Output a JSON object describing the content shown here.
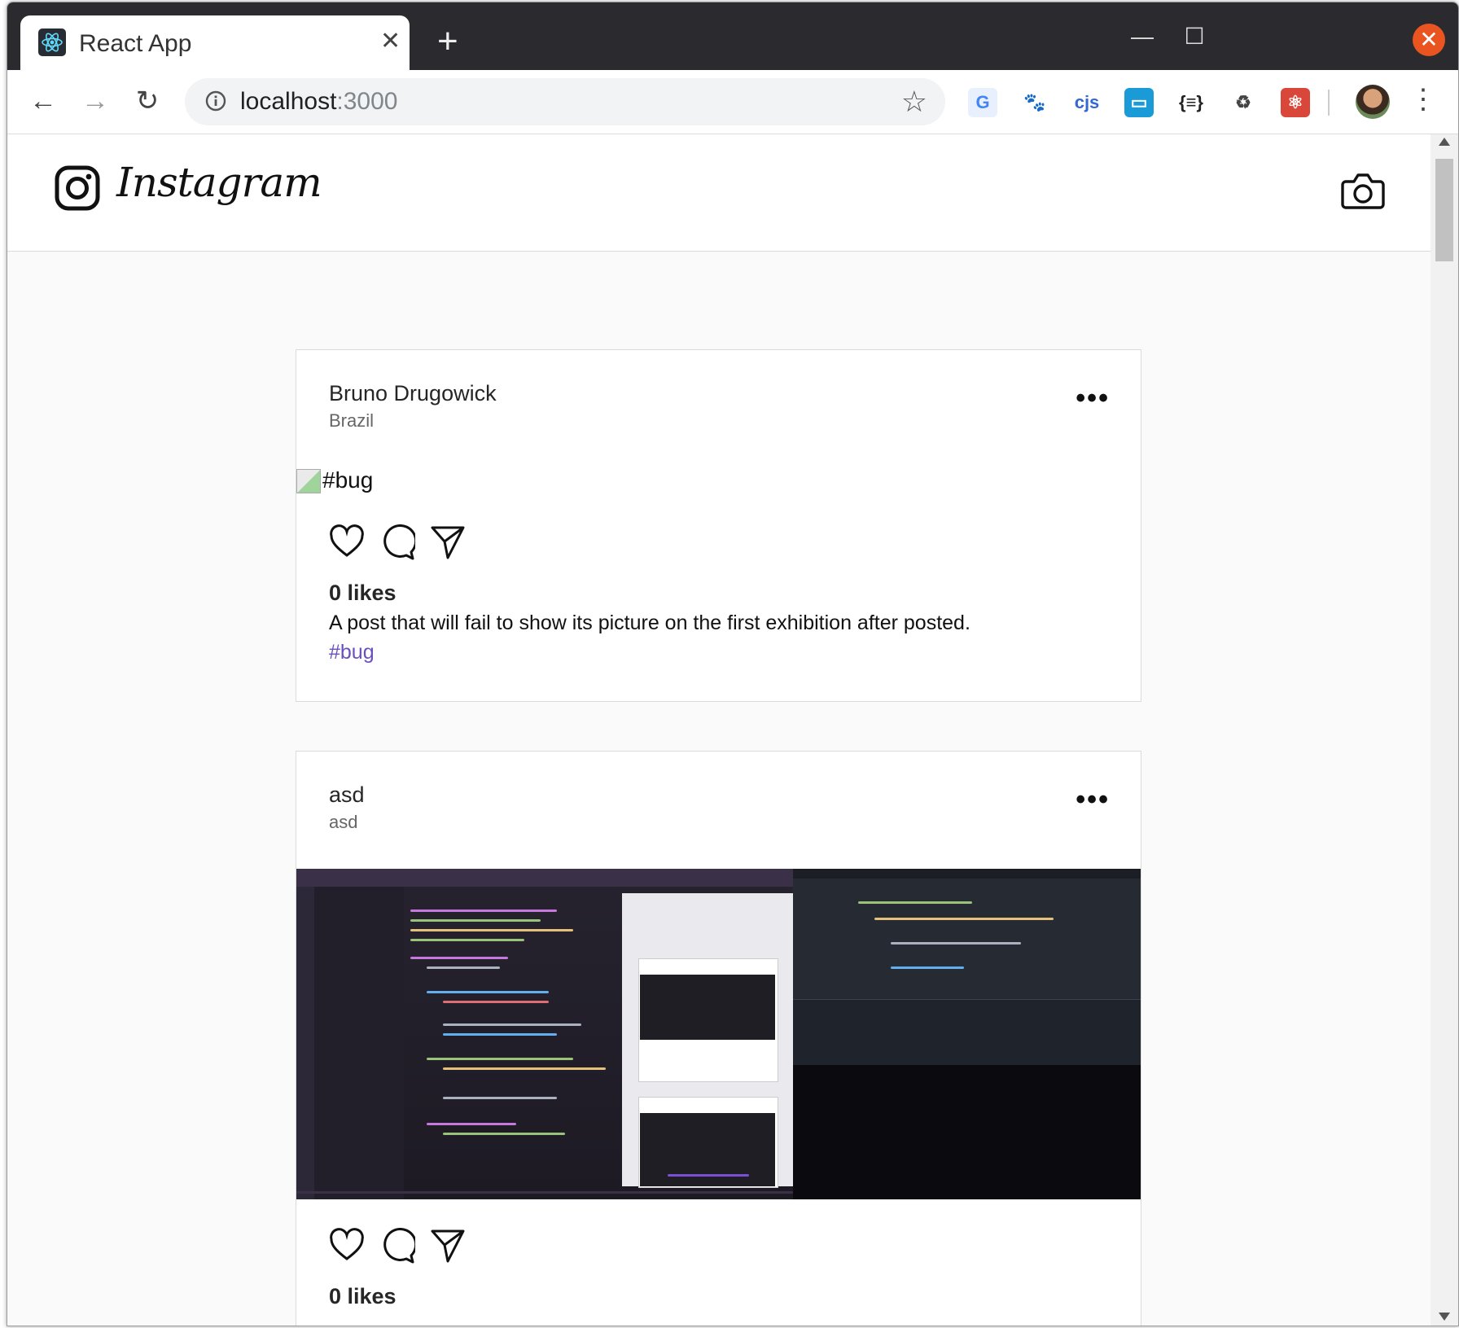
{
  "browser": {
    "tab_title": "React App",
    "tab_close": "✕",
    "new_tab": "+",
    "url_host": "localhost",
    "url_port": ":3000",
    "back": "←",
    "forward": "→",
    "reload": "↻",
    "star": "☆",
    "menu": "⋮",
    "min": "—",
    "max": "☐",
    "close": "✕",
    "extensions": [
      {
        "name": "google-translate-extension-icon",
        "label": "G",
        "color": "#4285f4",
        "bg": "#e8f0fe"
      },
      {
        "name": "gnome-extension-icon",
        "label": "🐾",
        "color": "#111111",
        "bg": "#ffffff"
      },
      {
        "name": "cjs-extension-icon",
        "label": "cjs",
        "color": "#3367d6",
        "bg": "#ffffff"
      },
      {
        "name": "window-extension-icon",
        "label": "▭",
        "color": "#ffffff",
        "bg": "#1a9bd7"
      },
      {
        "name": "json-formatter-extension-icon",
        "label": "{≡}",
        "color": "#222222",
        "bg": "#ffffff"
      },
      {
        "name": "recycle-extension-icon",
        "label": "♻",
        "color": "#444444",
        "bg": "#ffffff"
      },
      {
        "name": "react-devtools-extension-icon",
        "label": "⚛",
        "color": "#ffffff",
        "bg": "#d9473b"
      }
    ]
  },
  "app": {
    "logo_text": "Instagram"
  },
  "posts": [
    {
      "author": "Bruno Drugowick",
      "place": "Brazil",
      "more": "•••",
      "image_alt": "#bug",
      "likes": "0 likes",
      "description": "A post that will fail to show its picture on the first exhibition after posted.",
      "hashtags": "#bug"
    },
    {
      "author": "asd",
      "place": "asd",
      "more": "•••",
      "likes": "0 likes"
    }
  ],
  "colors": {
    "accent_hashtag": "#6b4fbb",
    "window_close": "#e95420",
    "page_bg": "#fafafa",
    "border": "#dbdbdb"
  }
}
